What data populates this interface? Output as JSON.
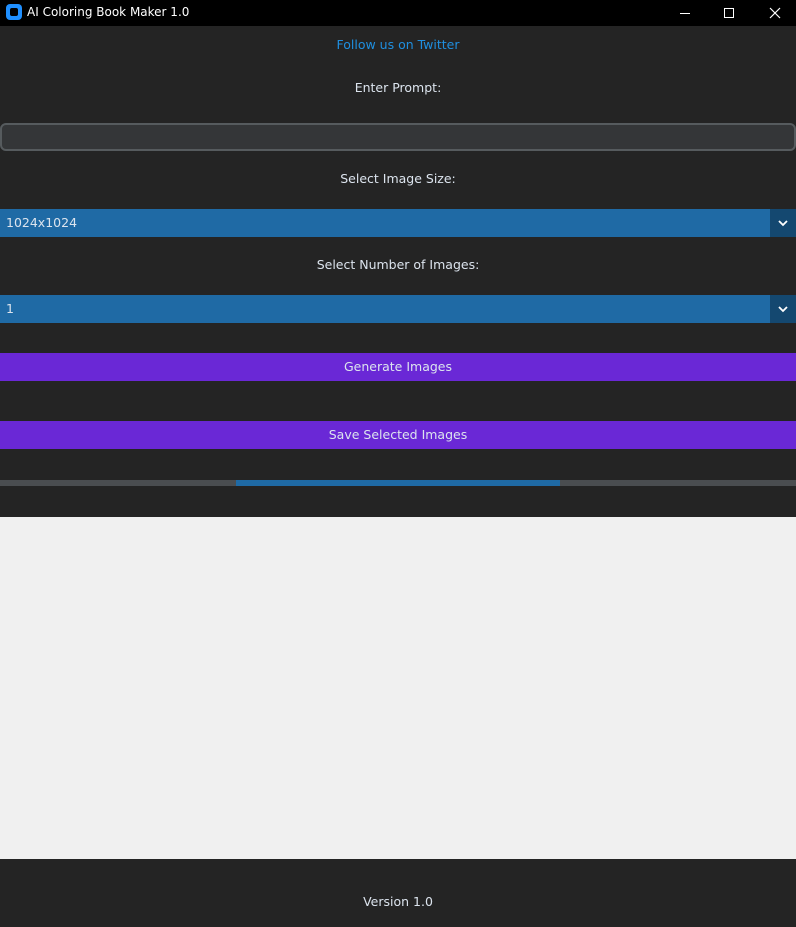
{
  "window": {
    "title": "AI Coloring Book Maker 1.0",
    "icon": "app-icon",
    "controls": [
      "minimize-icon",
      "maximize-icon",
      "close-icon"
    ]
  },
  "twitter_link": "Follow us on Twitter",
  "prompt": {
    "label": "Enter Prompt:",
    "value": "",
    "placeholder": ""
  },
  "image_size": {
    "label": "Select Image Size:",
    "selected": "1024x1024"
  },
  "num_images": {
    "label": "Select Number of Images:",
    "selected": "1"
  },
  "buttons": {
    "generate": "Generate Images",
    "save": "Save Selected Images"
  },
  "progress": {
    "mode": "indeterminate"
  },
  "footer": {
    "version": "Version 1.0"
  },
  "colors": {
    "background": "#242424",
    "accent_blue": "#1f6aa5",
    "button_purple": "#6a28d6",
    "link": "#1f8fe0",
    "image_area": "#f0f0f0"
  }
}
